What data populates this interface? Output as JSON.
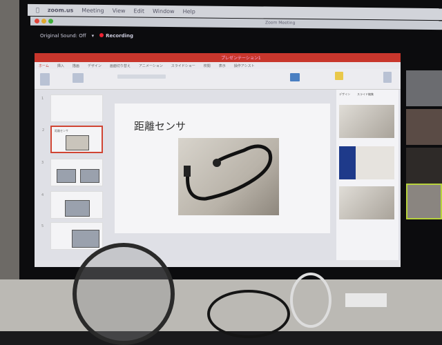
{
  "menubar": {
    "apple_icon": "apple-icon",
    "items": [
      "zoom.us",
      "Meeting",
      "View",
      "Edit",
      "Window",
      "Help"
    ]
  },
  "zoom_window": {
    "title": "Zoom Meeting",
    "original_sound": "Original Sound: Off",
    "recording": "Recording",
    "recording_color": "#e22233"
  },
  "powerpoint": {
    "title": "プレゼンテーション1",
    "accent": "#c8362c",
    "tabs": [
      "ホーム",
      "挿入",
      "描画",
      "デザイン",
      "画面切り替え",
      "アニメーション",
      "スライドショー",
      "校閲",
      "表示",
      "操作アシスト"
    ],
    "slides": [
      {
        "num": "1"
      },
      {
        "num": "2",
        "title": "距離センサ"
      },
      {
        "num": "3"
      },
      {
        "num": "4"
      },
      {
        "num": "5"
      }
    ],
    "current_slide": {
      "title": "距離センサ"
    },
    "design_panel": {
      "tabs": [
        "デザイン",
        "スライド編集"
      ]
    }
  }
}
